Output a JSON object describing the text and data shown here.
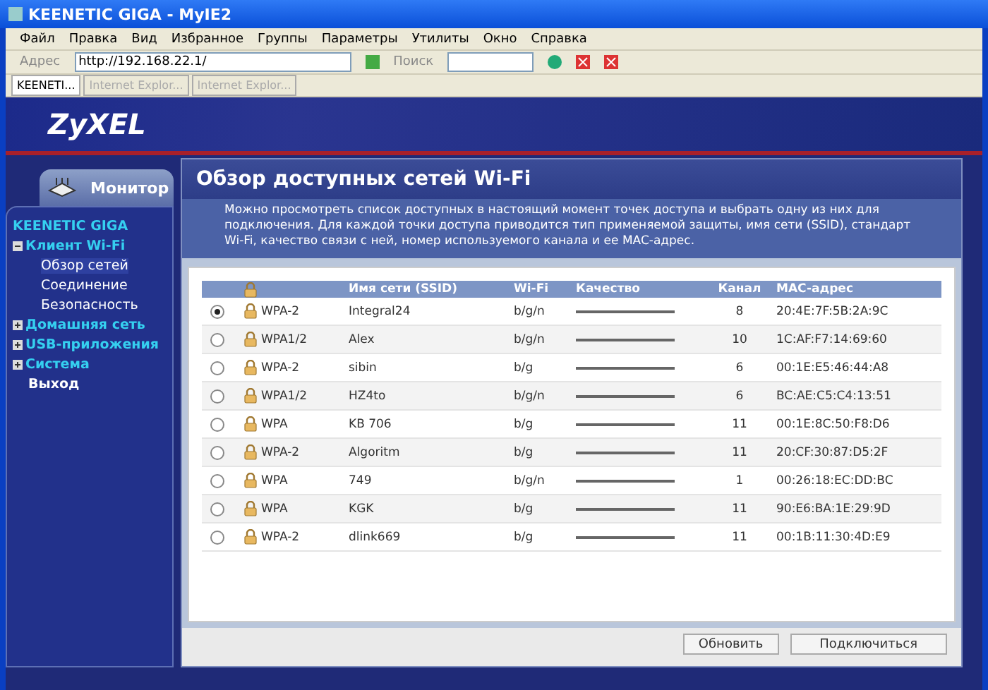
{
  "window": {
    "title": "KEENETIC GIGA - MyIE2"
  },
  "menu": [
    "Файл",
    "Правка",
    "Вид",
    "Избранное",
    "Группы",
    "Параметры",
    "Утилиты",
    "Окно",
    "Справка"
  ],
  "address_bar": {
    "label": "Адрес",
    "value": "http://192.168.22.1/"
  },
  "search_bar": {
    "label": "Поиск"
  },
  "browser_tabs": [
    {
      "label": "KEENETI...",
      "selected": true
    },
    {
      "label": "Internet Explor...",
      "selected": false
    },
    {
      "label": "Internet Explor...",
      "selected": false
    }
  ],
  "brand": {
    "logo": "ZyXEL"
  },
  "sidebar": {
    "section": "Монитор",
    "items": [
      {
        "label": "KEENETIC GIGA",
        "children": [
          {
            "label": "Клиент Wi-Fi",
            "expanded": true,
            "children": [
              {
                "label": "Обзор сетей",
                "selected": true
              },
              {
                "label": "Соединение",
                "selected": false
              },
              {
                "label": "Безопасность",
                "selected": false
              }
            ]
          },
          {
            "label": "Домашняя сеть",
            "expanded": false
          },
          {
            "label": "USB-приложения",
            "expanded": false
          },
          {
            "label": "Система",
            "expanded": false
          },
          {
            "label": "Выход"
          }
        ]
      }
    ]
  },
  "panel": {
    "title": "Обзор доступных сетей Wi-Fi",
    "description": "Можно просмотреть список доступных в настоящий момент точек доступа и выбрать одну из них для подключения. Для каждой точки доступа приводится тип применяемой защиты, имя сети (SSID), стандарт Wi-Fi, качество связи с ней, номер используемого канала и ее MAC-адрес."
  },
  "table": {
    "columns": [
      "Имя сети (SSID)",
      "Wi-Fi",
      "Качество",
      "Канал",
      "MAC-адрес"
    ],
    "rows": [
      {
        "selected": true,
        "security": "WPA-2",
        "ssid": "Integral24",
        "wifi": "b/g/n",
        "level": 1,
        "channel": "8",
        "mac": "20:4E:7F:5B:2A:9C"
      },
      {
        "selected": false,
        "security": "WPA1/2",
        "ssid": "Alex",
        "wifi": "b/g/n",
        "level": 1,
        "channel": "10",
        "mac": "1C:AF:F7:14:69:60"
      },
      {
        "selected": false,
        "security": "WPA-2",
        "ssid": "sibin",
        "wifi": "b/g",
        "level": 1,
        "channel": "6",
        "mac": "00:1E:E5:46:44:A8"
      },
      {
        "selected": false,
        "security": "WPA1/2",
        "ssid": "HZ4to",
        "wifi": "b/g/n",
        "level": 1,
        "channel": "6",
        "mac": "BC:AE:C5:C4:13:51"
      },
      {
        "selected": false,
        "security": "WPA",
        "ssid": "KB 706",
        "wifi": "b/g",
        "level": 1,
        "channel": "11",
        "mac": "00:1E:8C:50:F8:D6"
      },
      {
        "selected": false,
        "security": "WPA-2",
        "ssid": "Algoritm",
        "wifi": "b/g",
        "level": 1,
        "channel": "11",
        "mac": "20:CF:30:87:D5:2F"
      },
      {
        "selected": false,
        "security": "WPA",
        "ssid": "749",
        "wifi": "b/g/n",
        "level": 1,
        "channel": "1",
        "mac": "00:26:18:EC:DD:BC"
      },
      {
        "selected": false,
        "security": "WPA",
        "ssid": "KGK",
        "wifi": "b/g",
        "level": 1,
        "channel": "11",
        "mac": "90:E6:BA:1E:29:9D"
      },
      {
        "selected": false,
        "security": "WPA-2",
        "ssid": "dlink669",
        "wifi": "b/g",
        "level": 1,
        "channel": "11",
        "mac": "00:1B:11:30:4D:E9"
      }
    ]
  },
  "buttons": [
    "Обновить",
    "Подключиться"
  ]
}
